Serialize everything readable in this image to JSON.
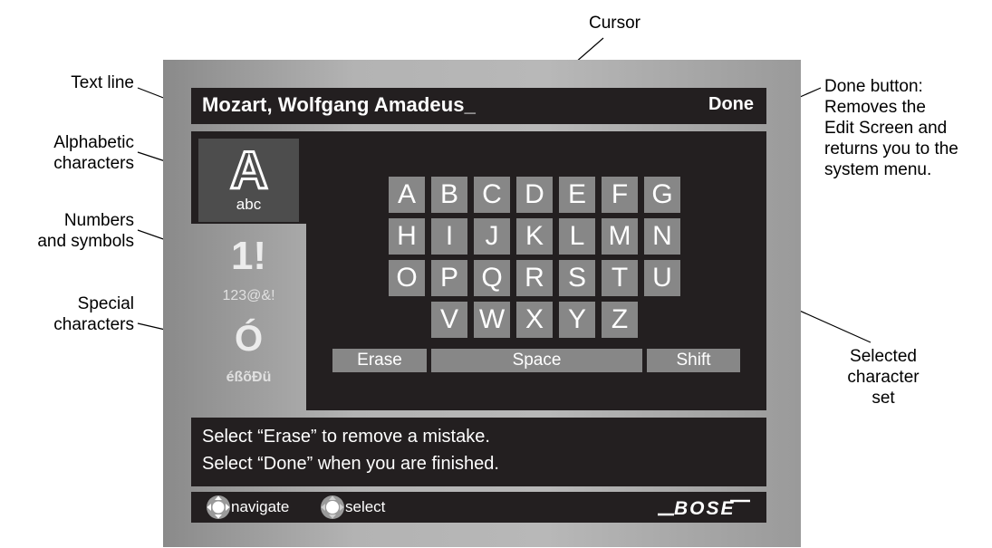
{
  "callouts": {
    "cursor": "Cursor",
    "text_line": "Text line",
    "alphabetic": [
      "Alphabetic",
      "characters"
    ],
    "numbers": [
      "Numbers",
      "and symbols"
    ],
    "special": [
      "Special",
      "characters"
    ],
    "done_button": [
      "Done button:",
      "Removes the",
      "Edit Screen and",
      "returns you to the",
      "system menu."
    ],
    "selected_set": [
      "Selected",
      "character",
      "set"
    ]
  },
  "screen": {
    "text_value": "Mozart, Wolfgang Amadeus_",
    "done_label": "Done",
    "tabs": {
      "alpha": {
        "glyph": "A",
        "caption": "abc"
      },
      "numbers": {
        "glyph": "1!",
        "caption": "123@&!"
      },
      "special": {
        "glyph": "Ó",
        "caption": "éßõÐü"
      }
    },
    "keyboard_rows": [
      [
        "A",
        "B",
        "C",
        "D",
        "E",
        "F",
        "G"
      ],
      [
        "H",
        "I",
        "J",
        "K",
        "L",
        "M",
        "N"
      ],
      [
        "O",
        "P",
        "Q",
        "R",
        "S",
        "T",
        "U"
      ],
      [
        "V",
        "W",
        "X",
        "Y",
        "Z"
      ]
    ],
    "buttons": {
      "erase": "Erase",
      "space": "Space",
      "shift": "Shift"
    },
    "messages": [
      "Select “Erase” to remove a mistake.",
      "Select “Done” when you are finished."
    ],
    "footer": {
      "navigate": "navigate",
      "select": "select",
      "logo": "BOSE"
    }
  },
  "colors": {
    "screen_dark": "#231f20",
    "key_gray": "#878787",
    "tab_selected": "#4d4d4d",
    "tab_inactive_text": "#d9d9d9"
  }
}
